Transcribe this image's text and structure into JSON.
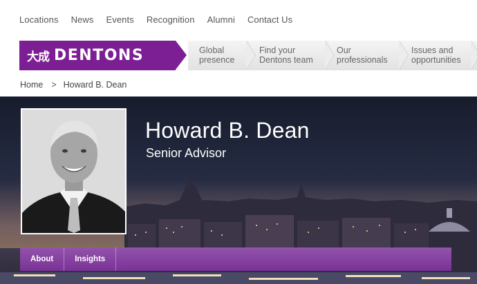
{
  "utility_nav": [
    "Locations",
    "News",
    "Events",
    "Recognition",
    "Alumni",
    "Contact Us"
  ],
  "logo": {
    "cjk": "大成",
    "text": "DENTONS",
    "color": "#7c1f94"
  },
  "main_nav": [
    {
      "line1": "Global",
      "line2": "presence"
    },
    {
      "line1": "Find your",
      "line2": "Dentons team"
    },
    {
      "line1": "Our",
      "line2": "professionals"
    },
    {
      "line1": "Issues and",
      "line2": "opportunities"
    }
  ],
  "breadcrumb": {
    "home": "Home",
    "separator": ">",
    "current": "Howard B. Dean"
  },
  "profile": {
    "name": "Howard B. Dean",
    "title": "Senior Advisor"
  },
  "tabs": [
    "About",
    "Insights"
  ],
  "colors": {
    "brand_purple": "#7c1f94",
    "tab_purple": "#8a45a6"
  }
}
